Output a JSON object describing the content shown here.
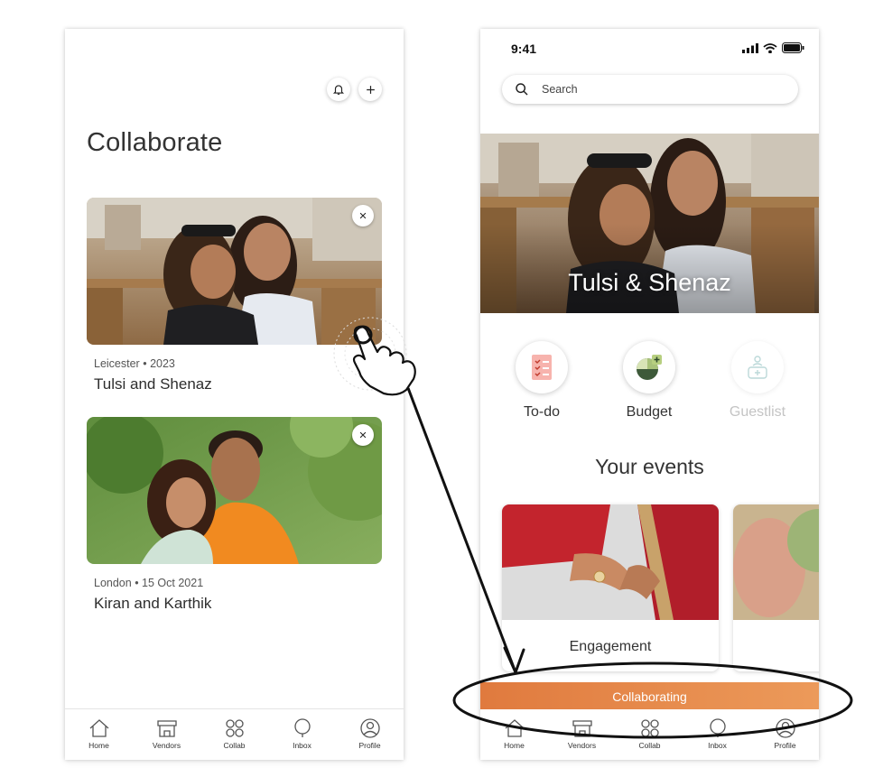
{
  "left_screen": {
    "title": "Collaborate",
    "header_icons": [
      "bell-icon",
      "plus-icon"
    ],
    "cards": [
      {
        "location": "Leicester",
        "date": "2023",
        "name": "Tulsi and Shenaz"
      },
      {
        "location": "London",
        "date": "15 Oct 2021",
        "name": "Kiran and Karthik"
      }
    ],
    "tabs": [
      {
        "label": "Home",
        "icon": "home-icon"
      },
      {
        "label": "Vendors",
        "icon": "shop-icon"
      },
      {
        "label": "Collab",
        "icon": "collab-icon"
      },
      {
        "label": "Inbox",
        "icon": "chat-icon"
      },
      {
        "label": "Profile",
        "icon": "profile-icon"
      }
    ]
  },
  "right_screen": {
    "status_time": "9:41",
    "search_placeholder": "Search",
    "hero_title": "Tulsi & Shenaz",
    "shortcuts": [
      {
        "label": "To-do",
        "icon": "todo-icon",
        "enabled": true
      },
      {
        "label": "Budget",
        "icon": "budget-icon",
        "enabled": true
      },
      {
        "label": "Guestlist",
        "icon": "guestlist-icon",
        "enabled": false
      }
    ],
    "section_title": "Your events",
    "events": [
      {
        "label": "Engagement"
      },
      {
        "label": ""
      }
    ],
    "banner": "Collaborating",
    "tabs": [
      {
        "label": "Home",
        "icon": "home-icon"
      },
      {
        "label": "Vendors",
        "icon": "shop-icon"
      },
      {
        "label": "Collab",
        "icon": "collab-icon"
      },
      {
        "label": "Inbox",
        "icon": "chat-icon"
      },
      {
        "label": "Profile",
        "icon": "profile-icon"
      }
    ]
  },
  "colors": {
    "accent": "#E8874A",
    "text": "#333333",
    "disabled": "#C4C4C4"
  }
}
